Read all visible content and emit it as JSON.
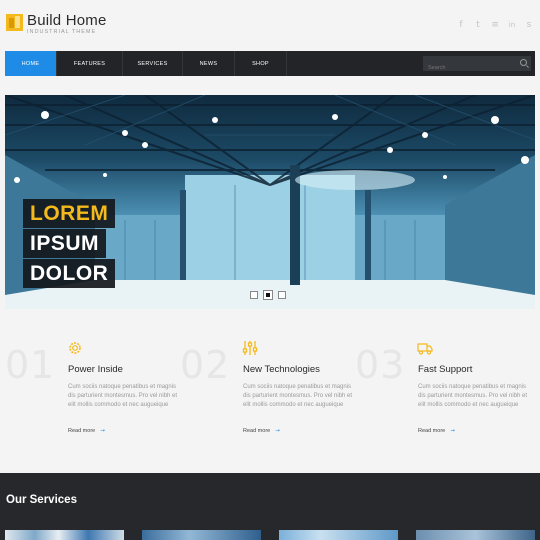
{
  "header": {
    "logo_title": "Build Home",
    "logo_tagline": "INDUSTRIAL THEME",
    "social": [
      {
        "icon": "facebook-icon",
        "glyph": "f"
      },
      {
        "icon": "twitter-icon",
        "glyph": "t"
      },
      {
        "icon": "rss-icon",
        "glyph": "≡"
      },
      {
        "icon": "linkedin-icon",
        "glyph": "in"
      },
      {
        "icon": "skype-icon",
        "glyph": "s"
      }
    ]
  },
  "nav": {
    "items": [
      "HOME",
      "FEATURES",
      "SERVICES",
      "NEWS",
      "SHOP"
    ],
    "active": "HOME",
    "accent": "#1e8ce6",
    "search_placeholder": "Search"
  },
  "hero": {
    "caption": [
      "LOREM",
      "IPSUM",
      "DOLOR"
    ],
    "caption_accent": "#f4b91c",
    "slides": 3,
    "active_slide": 2
  },
  "features": [
    {
      "number": "01",
      "icon": "gear-icon",
      "title": "Power Inside",
      "text": "Cum sociis natoque penatibus et magnis dis parturient montesmus. Pro vel nibh et elit mollis commodo et nec augueique",
      "more": "Read more"
    },
    {
      "number": "02",
      "icon": "sliders-icon",
      "title": "New Technologies",
      "text": "Cum sociis natoque penatibus et magnis dis parturient montesmus. Pro vel nibh et elit mollis commodo et nec augueique",
      "more": "Read more"
    },
    {
      "number": "03",
      "icon": "truck-icon",
      "title": "Fast Support",
      "text": "Cum sociis natoque penatibus et magnis dis parturient montesmus. Pro vel nibh et elit mollis commodo et nec augueique",
      "more": "Read more"
    }
  ],
  "services": {
    "title": "Our Services"
  }
}
